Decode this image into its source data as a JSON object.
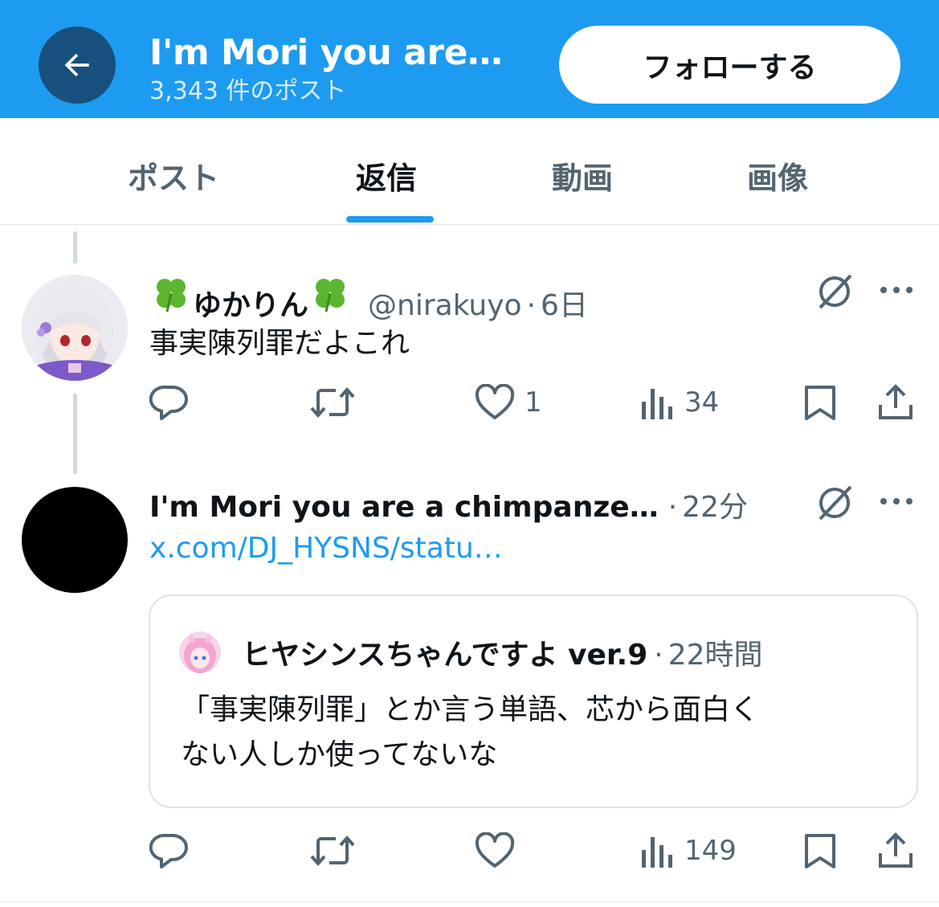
{
  "header": {
    "title": "I'm Mori you are…",
    "post_count": "3,343 件のポスト",
    "follow_label": "フォローする"
  },
  "tabs": [
    {
      "label": "ポスト",
      "active": false
    },
    {
      "label": "返信",
      "active": true
    },
    {
      "label": "動画",
      "active": false
    },
    {
      "label": "画像",
      "active": false
    }
  ],
  "posts": [
    {
      "display_name": "ゆかりん",
      "handle": "@nirakuyo",
      "separator": "·",
      "time": "6日",
      "text": "事実陳列罪だよこれ",
      "reply_count": "",
      "repost_count": "",
      "like_count": "1",
      "view_count": "34"
    },
    {
      "display_name": "I'm Mori you are a chimpanze…",
      "separator": "·",
      "time": "22分",
      "link": "x.com/DJ_HYSNS/statu…",
      "quote": {
        "display_name": "ヒヤシンスちゃんですよ ver.9",
        "separator": "·",
        "time": "22時間",
        "text_line1": "「事実陳列罪」とか言う単語、芯から面白く",
        "text_line2": "ない人しか使ってないな"
      },
      "reply_count": "",
      "repost_count": "",
      "like_count": "",
      "view_count": "149"
    }
  ],
  "colors": {
    "brand": "#1d9bf0",
    "back_button": "#17507c",
    "text_primary": "#0f1419",
    "text_secondary": "#536471"
  },
  "icons": [
    "back-arrow-icon",
    "clover-icon",
    "grok-icon",
    "more-icon",
    "reply-icon",
    "repost-icon",
    "like-icon",
    "views-icon",
    "bookmark-icon",
    "share-icon"
  ]
}
